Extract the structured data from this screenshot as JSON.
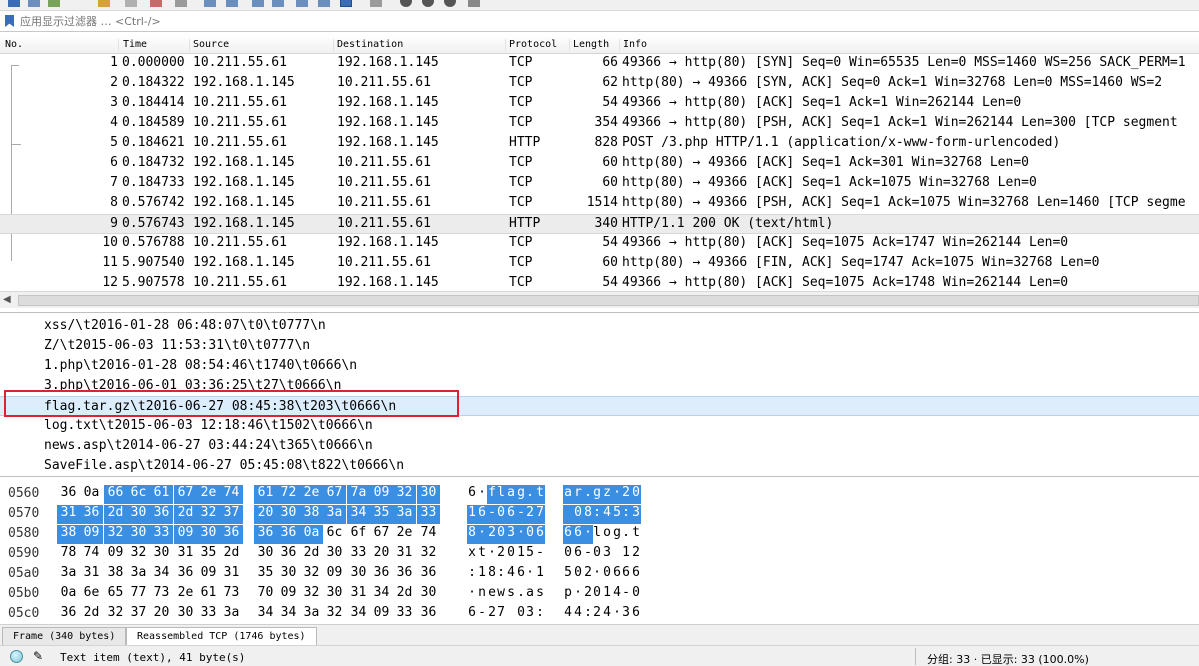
{
  "filter": {
    "placeholder": "应用显示过滤器 … <Ctrl-/>"
  },
  "packet_list": {
    "columns": [
      "No.",
      "Time",
      "Source",
      "Destination",
      "Protocol",
      "Length",
      "Info"
    ],
    "rows": [
      {
        "no": "1",
        "time": "0.000000",
        "src": "10.211.55.61",
        "dst": "192.168.1.145",
        "proto": "TCP",
        "len": "66",
        "info": "49366 → http(80) [SYN] Seq=0 Win=65535 Len=0 MSS=1460 WS=256 SACK_PERM=1"
      },
      {
        "no": "2",
        "time": "0.184322",
        "src": "192.168.1.145",
        "dst": "10.211.55.61",
        "proto": "TCP",
        "len": "62",
        "info": "http(80) → 49366 [SYN, ACK] Seq=0 Ack=1 Win=32768 Len=0 MSS=1460 WS=2"
      },
      {
        "no": "3",
        "time": "0.184414",
        "src": "10.211.55.61",
        "dst": "192.168.1.145",
        "proto": "TCP",
        "len": "54",
        "info": "49366 → http(80) [ACK] Seq=1 Ack=1 Win=262144 Len=0"
      },
      {
        "no": "4",
        "time": "0.184589",
        "src": "10.211.55.61",
        "dst": "192.168.1.145",
        "proto": "TCP",
        "len": "354",
        "info": "49366 → http(80) [PSH, ACK] Seq=1 Ack=1 Win=262144 Len=300 [TCP segment"
      },
      {
        "no": "5",
        "time": "0.184621",
        "src": "10.211.55.61",
        "dst": "192.168.1.145",
        "proto": "HTTP",
        "len": "828",
        "info": "POST /3.php HTTP/1.1  (application/x-www-form-urlencoded)"
      },
      {
        "no": "6",
        "time": "0.184732",
        "src": "192.168.1.145",
        "dst": "10.211.55.61",
        "proto": "TCP",
        "len": "60",
        "info": "http(80) → 49366 [ACK] Seq=1 Ack=301 Win=32768 Len=0"
      },
      {
        "no": "7",
        "time": "0.184733",
        "src": "192.168.1.145",
        "dst": "10.211.55.61",
        "proto": "TCP",
        "len": "60",
        "info": "http(80) → 49366 [ACK] Seq=1 Ack=1075 Win=32768 Len=0"
      },
      {
        "no": "8",
        "time": "0.576742",
        "src": "192.168.1.145",
        "dst": "10.211.55.61",
        "proto": "TCP",
        "len": "1514",
        "info": "http(80) → 49366 [PSH, ACK] Seq=1 Ack=1075 Win=32768 Len=1460 [TCP segme"
      },
      {
        "no": "9",
        "time": "0.576743",
        "src": "192.168.1.145",
        "dst": "10.211.55.61",
        "proto": "HTTP",
        "len": "340",
        "info": "HTTP/1.1 200 OK  (text/html)"
      },
      {
        "no": "10",
        "time": "0.576788",
        "src": "10.211.55.61",
        "dst": "192.168.1.145",
        "proto": "TCP",
        "len": "54",
        "info": "49366 → http(80) [ACK] Seq=1075 Ack=1747 Win=262144 Len=0"
      },
      {
        "no": "11",
        "time": "5.907540",
        "src": "192.168.1.145",
        "dst": "10.211.55.61",
        "proto": "TCP",
        "len": "60",
        "info": "http(80) → 49366 [FIN, ACK] Seq=1747 Ack=1075 Win=32768 Len=0"
      },
      {
        "no": "12",
        "time": "5.907578",
        "src": "10.211.55.61",
        "dst": "192.168.1.145",
        "proto": "TCP",
        "len": "54",
        "info": "49366 → http(80) [ACK] Seq=1075 Ack=1748 Win=262144 Len=0"
      }
    ]
  },
  "details": {
    "lines": [
      "xss/\\t2016-01-28 06:48:07\\t0\\t0777\\n",
      "Z/\\t2015-06-03 11:53:31\\t0\\t0777\\n",
      "1.php\\t2016-01-28 08:54:46\\t1740\\t0666\\n",
      "3.php\\t2016-06-01 03:36:25\\t27\\t0666\\n",
      "flag.tar.gz\\t2016-06-27 08:45:38\\t203\\t0666\\n",
      "log.txt\\t2015-06-03 12:18:46\\t1502\\t0666\\n",
      "news.asp\\t2014-06-27 03:44:24\\t365\\t0666\\n",
      "SaveFile.asp\\t2014-06-27 05:45:08\\t822\\t0666\\n"
    ]
  },
  "bytes": {
    "rows": [
      {
        "offset": "0560",
        "hex": [
          "36",
          "0a",
          "66",
          "6c",
          "61",
          "67",
          "2e",
          "74",
          "61",
          "72",
          "2e",
          "67",
          "7a",
          "09",
          "32",
          "30"
        ],
        "ascii": [
          "6",
          "·",
          "f",
          "l",
          "a",
          "g",
          ".",
          "t",
          "a",
          "r",
          ".",
          "g",
          "z",
          "·",
          "2",
          "0"
        ],
        "hl_start": 2,
        "hl_end": 15
      },
      {
        "offset": "0570",
        "hex": [
          "31",
          "36",
          "2d",
          "30",
          "36",
          "2d",
          "32",
          "37",
          "20",
          "30",
          "38",
          "3a",
          "34",
          "35",
          "3a",
          "33"
        ],
        "ascii": [
          "1",
          "6",
          "-",
          "0",
          "6",
          "-",
          "2",
          "7",
          " ",
          "0",
          "8",
          ":",
          "4",
          "5",
          ":",
          "3"
        ],
        "hl_start": 0,
        "hl_end": 15
      },
      {
        "offset": "0580",
        "hex": [
          "38",
          "09",
          "32",
          "30",
          "33",
          "09",
          "30",
          "36",
          "36",
          "36",
          "0a",
          "6c",
          "6f",
          "67",
          "2e",
          "74"
        ],
        "ascii": [
          "8",
          "·",
          "2",
          "0",
          "3",
          "·",
          "0",
          "6",
          "6",
          "6",
          "·",
          "l",
          "o",
          "g",
          ".",
          "t"
        ],
        "hl_start": 0,
        "hl_end": 10
      },
      {
        "offset": "0590",
        "hex": [
          "78",
          "74",
          "09",
          "32",
          "30",
          "31",
          "35",
          "2d",
          "30",
          "36",
          "2d",
          "30",
          "33",
          "20",
          "31",
          "32"
        ],
        "ascii": [
          "x",
          "t",
          "·",
          "2",
          "0",
          "1",
          "5",
          "-",
          "0",
          "6",
          "-",
          "0",
          "3",
          " ",
          "1",
          "2"
        ],
        "hl_start": -1,
        "hl_end": -1
      },
      {
        "offset": "05a0",
        "hex": [
          "3a",
          "31",
          "38",
          "3a",
          "34",
          "36",
          "09",
          "31",
          "35",
          "30",
          "32",
          "09",
          "30",
          "36",
          "36",
          "36"
        ],
        "ascii": [
          ":",
          "1",
          "8",
          ":",
          "4",
          "6",
          "·",
          "1",
          "5",
          "0",
          "2",
          "·",
          "0",
          "6",
          "6",
          "6"
        ],
        "hl_start": -1,
        "hl_end": -1
      },
      {
        "offset": "05b0",
        "hex": [
          "0a",
          "6e",
          "65",
          "77",
          "73",
          "2e",
          "61",
          "73",
          "70",
          "09",
          "32",
          "30",
          "31",
          "34",
          "2d",
          "30"
        ],
        "ascii": [
          "·",
          "n",
          "e",
          "w",
          "s",
          ".",
          "a",
          "s",
          "p",
          "·",
          "2",
          "0",
          "1",
          "4",
          "-",
          "0"
        ],
        "hl_start": -1,
        "hl_end": -1
      },
      {
        "offset": "05c0",
        "hex": [
          "36",
          "2d",
          "32",
          "37",
          "20",
          "30",
          "33",
          "3a",
          "34",
          "34",
          "3a",
          "32",
          "34",
          "09",
          "33",
          "36"
        ],
        "ascii": [
          "6",
          "-",
          "2",
          "7",
          " ",
          "0",
          "3",
          ":",
          "4",
          "4",
          ":",
          "2",
          "4",
          "·",
          "3",
          "6"
        ],
        "hl_start": -1,
        "hl_end": -1
      }
    ]
  },
  "tabs": {
    "frame": "Frame (340 bytes)",
    "reassembled": "Reassembled TCP (1746 bytes)"
  },
  "status": {
    "item_text": "Text item (text), 41 byte(s)",
    "stats": "分组: 33 · 已显示: 33 (100.0%)"
  },
  "colors": {
    "selection_blue": "#3b8fe3",
    "annotation_red": "#e0222b"
  }
}
